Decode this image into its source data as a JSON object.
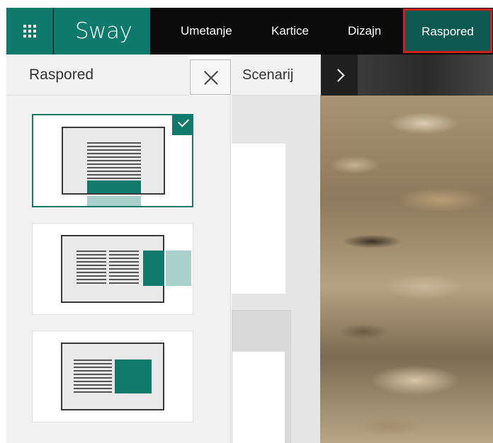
{
  "app": {
    "name": "Sway"
  },
  "ribbon": {
    "tabs": [
      {
        "label": "Umetanje"
      },
      {
        "label": "Kartice"
      },
      {
        "label": "Dizajn"
      },
      {
        "label": "Raspored",
        "selected": true,
        "highlight_color": "#d31e1e"
      }
    ]
  },
  "pane": {
    "title": "Raspored",
    "storyline_tab": "Scenarij"
  },
  "layouts": [
    {
      "name": "vertical",
      "selected": true
    },
    {
      "name": "horizontal",
      "selected": false
    },
    {
      "name": "slides",
      "selected": false
    }
  ],
  "colors": {
    "brand": "#0e7a6b",
    "accent": "#127a6b",
    "accent_light": "#a9d0cb",
    "topbar": "#0b0b0b"
  },
  "icons": {
    "launcher": "app-launcher-waffle-icon",
    "close": "close-icon",
    "next": "chevron-right-icon",
    "selected": "checkmark-icon"
  }
}
